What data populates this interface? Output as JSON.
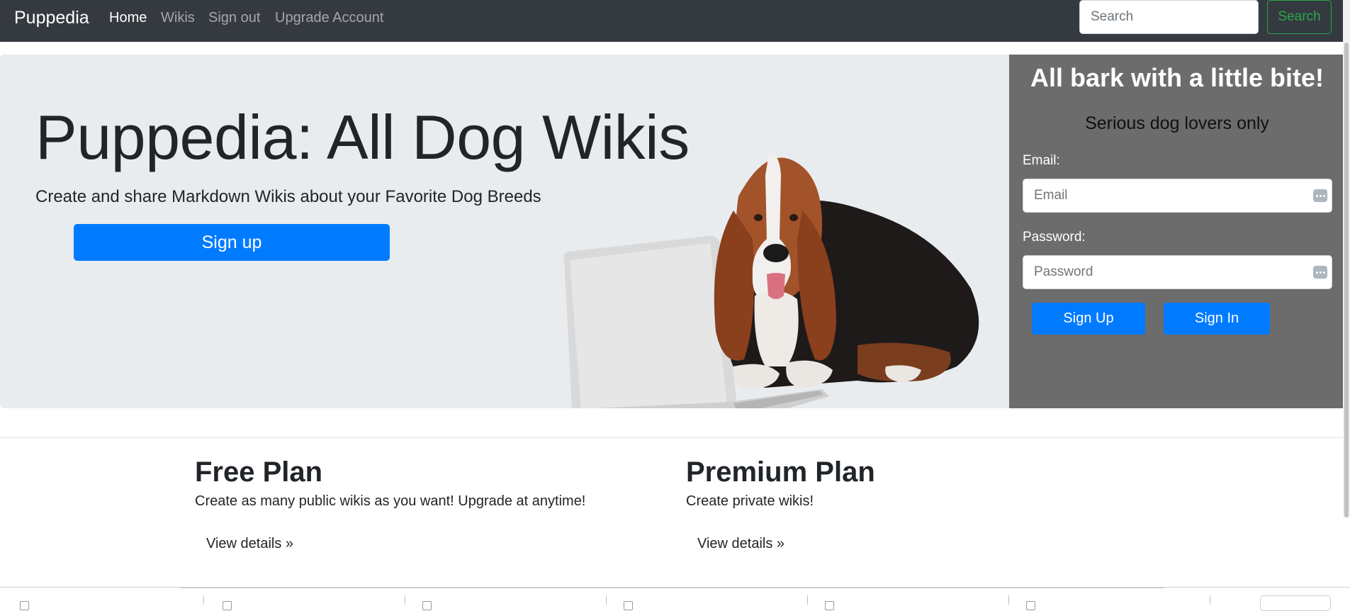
{
  "navbar": {
    "brand": "Puppedia",
    "links": [
      "Home",
      "Wikis",
      "Sign out",
      "Upgrade Account"
    ],
    "search_placeholder": "Search",
    "search_button": "Search"
  },
  "hero": {
    "title": "Puppedia: All Dog Wikis",
    "lead": "Create and share Markdown Wikis about your Favorite Dog Breeds",
    "signup_button": "Sign up",
    "illustration": "dog-with-laptop-illustration"
  },
  "signup_panel": {
    "title": "All bark with a little bite!",
    "subtitle": "Serious dog lovers only",
    "email_label": "Email:",
    "email_placeholder": "Email",
    "password_label": "Password:",
    "password_placeholder": "Password",
    "signup_button": "Sign Up",
    "signin_button": "Sign In"
  },
  "plans": [
    {
      "title": "Free Plan",
      "description": "Create as many public wikis as you want! Upgrade at anytime!",
      "link": "View details »"
    },
    {
      "title": "Premium Plan",
      "description": "Create private wikis!",
      "link": "View details »"
    }
  ],
  "colors": {
    "navbar_bg": "#343a40",
    "primary": "#007bff",
    "success": "#28a745",
    "jumbotron_bg": "#e9ecef",
    "panel_bg": "#6c6c6c"
  }
}
